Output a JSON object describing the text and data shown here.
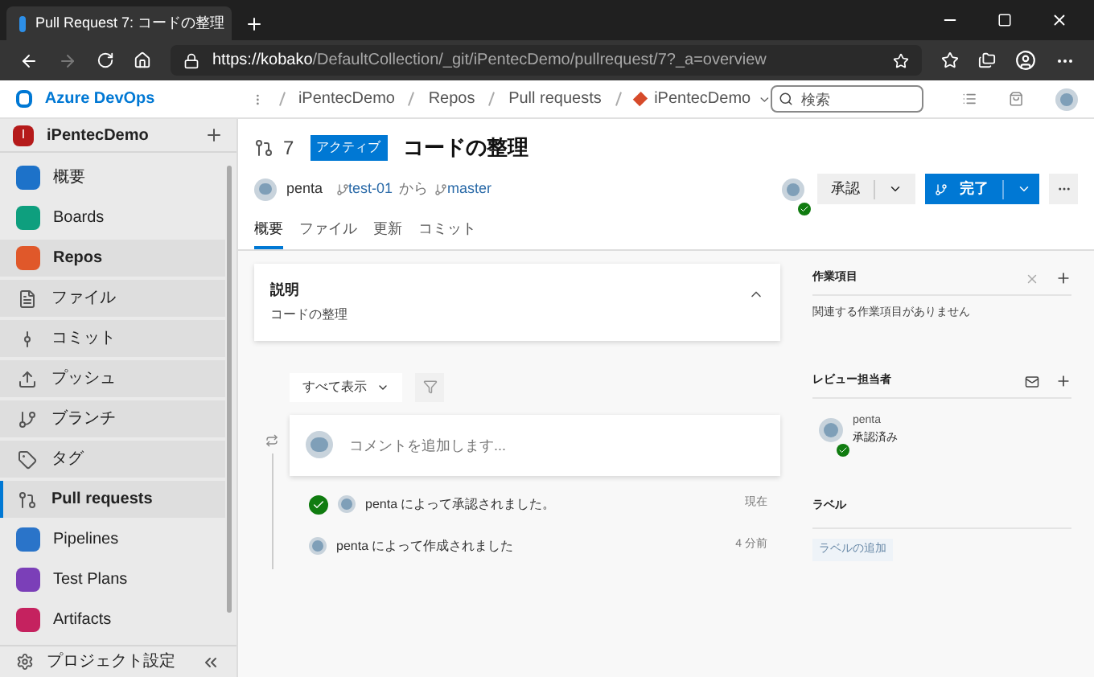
{
  "browser": {
    "tab_title": "Pull Request 7: コードの整理",
    "url_start": "https://kobako",
    "url_rest": "/DefaultCollection/_git/iPentecDemo/pullrequest/7?_a=overview"
  },
  "header": {
    "product": "Azure DevOps",
    "breadcrumbs": [
      {
        "label": "iPentecDemo",
        "kind": "text"
      },
      {
        "label": "Repos",
        "kind": "text"
      },
      {
        "label": "Pull requests",
        "kind": "text"
      },
      {
        "label": "iPentecDemo",
        "kind": "repo"
      }
    ],
    "search": {
      "placeholder": "検索"
    }
  },
  "sidebar": {
    "project": {
      "initial": "I",
      "name": "iPentecDemo"
    },
    "items": [
      {
        "label": "概要",
        "kind": "service",
        "selected": false,
        "in_group": false
      },
      {
        "label": "Boards",
        "kind": "service",
        "selected": false,
        "in_group": false
      },
      {
        "label": "Repos",
        "kind": "service",
        "selected": false,
        "in_group": true
      },
      {
        "label": "ファイル",
        "kind": "sub",
        "selected": false,
        "in_group": true
      },
      {
        "label": "コミット",
        "kind": "sub",
        "selected": false,
        "in_group": true
      },
      {
        "label": "プッシュ",
        "kind": "sub",
        "selected": false,
        "in_group": true
      },
      {
        "label": "ブランチ",
        "kind": "sub",
        "selected": false,
        "in_group": true
      },
      {
        "label": "タグ",
        "kind": "sub",
        "selected": false,
        "in_group": true
      },
      {
        "label": "Pull requests",
        "kind": "sub",
        "selected": true,
        "in_group": true
      },
      {
        "label": "Pipelines",
        "kind": "service",
        "selected": false,
        "in_group": false
      },
      {
        "label": "Test Plans",
        "kind": "service",
        "selected": false,
        "in_group": false
      },
      {
        "label": "Artifacts",
        "kind": "service",
        "selected": false,
        "in_group": false
      }
    ],
    "settings": "プロジェクト設定"
  },
  "pr": {
    "number": "7",
    "status": "アクティブ",
    "title": "コードの整理",
    "author": "penta",
    "source": "test-01",
    "from": "から",
    "target": "master",
    "approve": "承認",
    "complete": "完了",
    "tabs": [
      {
        "label": "概要",
        "selected": true
      },
      {
        "label": "ファイル",
        "selected": false
      },
      {
        "label": "更新",
        "selected": false
      },
      {
        "label": "コミット",
        "selected": false
      }
    ]
  },
  "description": {
    "heading": "説明",
    "text": "コードの整理",
    "expanded": true
  },
  "filter": "すべて表示",
  "comment": {
    "placeholder": "コメントを追加します..."
  },
  "timeline": [
    {
      "kind": "approved",
      "text": "penta によって承認されました。",
      "time": "現在"
    },
    {
      "kind": "created",
      "text": "penta によって作成されました",
      "time": "4 分前"
    }
  ],
  "work_items": {
    "title": "作業項目",
    "empty": "関連する作業項目がありません"
  },
  "reviewers": {
    "title": "レビュー担当者",
    "items": [
      {
        "name": "penta",
        "status": "承認済み",
        "approved": true
      }
    ]
  },
  "labels": {
    "title": "ラベル",
    "add": "ラベルの追加"
  }
}
